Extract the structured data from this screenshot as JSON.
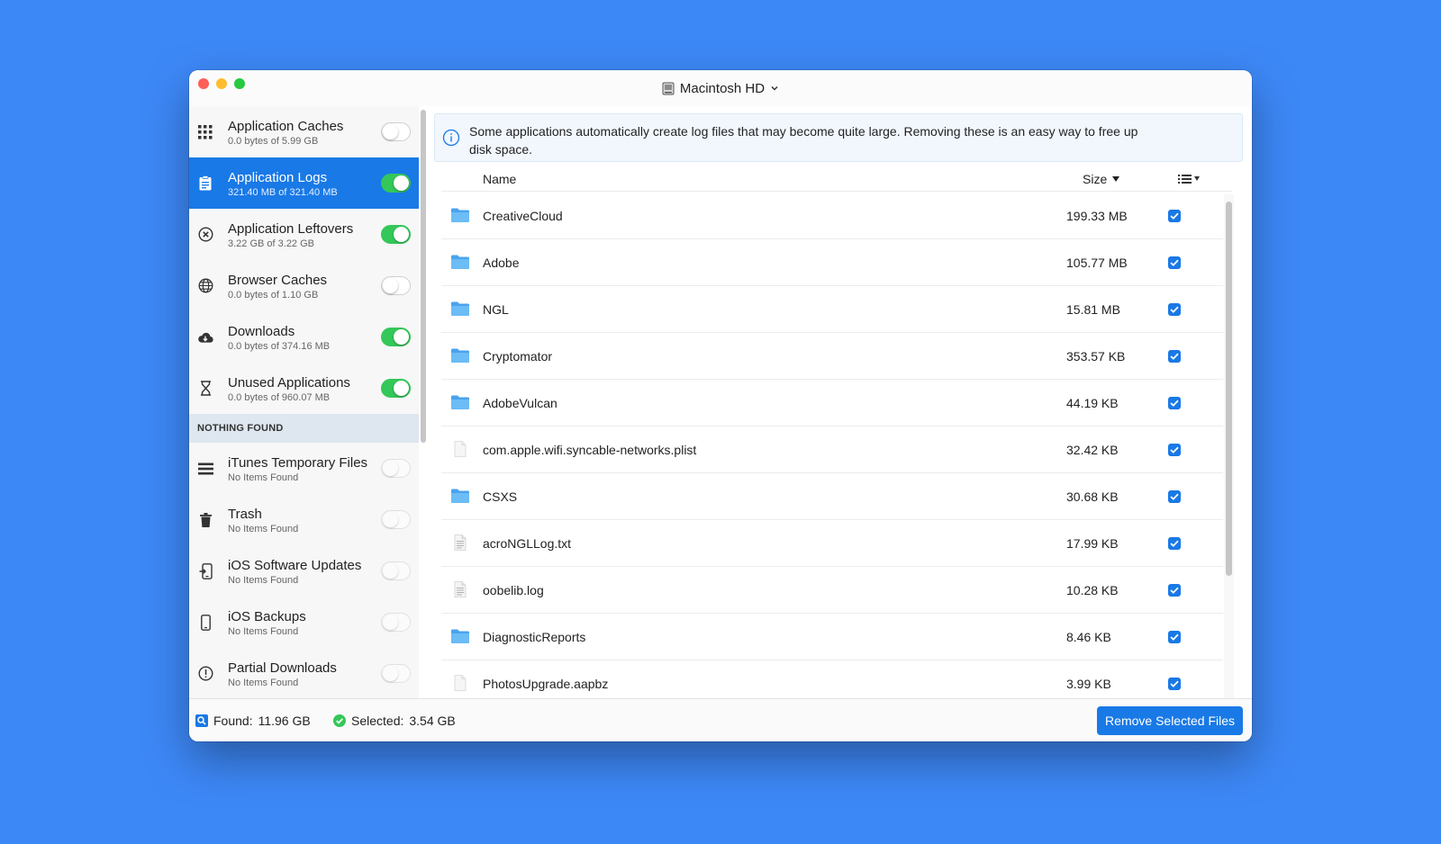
{
  "window": {
    "title": "Macintosh HD"
  },
  "sidebar": {
    "items": [
      {
        "title": "Application Caches",
        "subtitle": "0.0 bytes of 5.99 GB",
        "icon": "grid-icon",
        "enabled": false,
        "active": false
      },
      {
        "title": "Application Logs",
        "subtitle": "321.40 MB of 321.40 MB",
        "icon": "clipboard-icon",
        "enabled": true,
        "active": true
      },
      {
        "title": "Application Leftovers",
        "subtitle": "3.22 GB of 3.22 GB",
        "icon": "x-circle-icon",
        "enabled": true,
        "active": false
      },
      {
        "title": "Browser Caches",
        "subtitle": "0.0 bytes of 1.10 GB",
        "icon": "globe-icon",
        "enabled": false,
        "active": false
      },
      {
        "title": "Downloads",
        "subtitle": "0.0 bytes of 374.16 MB",
        "icon": "cloud-download-icon",
        "enabled": true,
        "active": false
      },
      {
        "title": "Unused Applications",
        "subtitle": "0.0 bytes of 960.07 MB",
        "icon": "hourglass-icon",
        "enabled": true,
        "active": false
      }
    ],
    "section_label": "NOTHING FOUND",
    "empty_items": [
      {
        "title": "iTunes Temporary Files",
        "subtitle": "No Items Found",
        "icon": "list-icon"
      },
      {
        "title": "Trash",
        "subtitle": "No Items Found",
        "icon": "trash-icon"
      },
      {
        "title": "iOS Software Updates",
        "subtitle": "No Items Found",
        "icon": "phone-update-icon"
      },
      {
        "title": "iOS Backups",
        "subtitle": "No Items Found",
        "icon": "phone-icon"
      },
      {
        "title": "Partial Downloads",
        "subtitle": "No Items Found",
        "icon": "exclamation-circle-icon"
      }
    ]
  },
  "banner": {
    "line1": "Some applications automatically create log files that may become quite large. Removing these is an easy way to free up",
    "line2": "disk space."
  },
  "table": {
    "col_name": "Name",
    "col_size": "Size",
    "rows": [
      {
        "name": "CreativeCloud",
        "size": "199.33 MB",
        "type": "folder",
        "checked": true
      },
      {
        "name": "Adobe",
        "size": "105.77 MB",
        "type": "folder",
        "checked": true
      },
      {
        "name": "NGL",
        "size": "15.81 MB",
        "type": "folder",
        "checked": true
      },
      {
        "name": "Cryptomator",
        "size": "353.57 KB",
        "type": "folder",
        "checked": true
      },
      {
        "name": "AdobeVulcan",
        "size": "44.19 KB",
        "type": "folder",
        "checked": true
      },
      {
        "name": "com.apple.wifi.syncable-networks.plist",
        "size": "32.42 KB",
        "type": "file",
        "checked": true
      },
      {
        "name": "CSXS",
        "size": "30.68 KB",
        "type": "folder",
        "checked": true
      },
      {
        "name": "acroNGLLog.txt",
        "size": "17.99 KB",
        "type": "text",
        "checked": true
      },
      {
        "name": "oobelib.log",
        "size": "10.28 KB",
        "type": "text",
        "checked": true
      },
      {
        "name": "DiagnosticReports",
        "size": "8.46 KB",
        "type": "folder",
        "checked": true
      },
      {
        "name": "PhotosUpgrade.aapbz",
        "size": "3.99 KB",
        "type": "file",
        "checked": true
      }
    ]
  },
  "footer": {
    "found_label": "Found:",
    "found_value": "11.96 GB",
    "selected_label": "Selected:",
    "selected_value": "3.54 GB",
    "remove_button": "Remove Selected Files"
  },
  "colors": {
    "accent": "#1979e6",
    "toggle_on": "#34c759",
    "folder": "#5eb0f2",
    "background": "#3d88f7"
  }
}
